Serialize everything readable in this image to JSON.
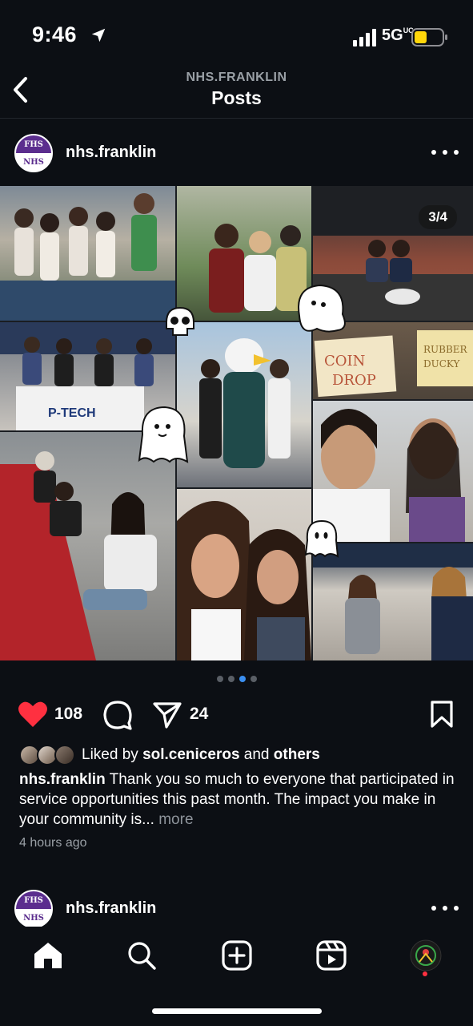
{
  "status_bar": {
    "time": "9:46",
    "network": "5G",
    "network_suffix": "UC"
  },
  "header": {
    "subtitle": "NHS.FRANKLIN",
    "title": "Posts"
  },
  "post": {
    "avatar_top_text": "FHS",
    "avatar_bottom_text": "NHS",
    "username": "nhs.franklin",
    "slide_counter": "3/4",
    "carousel": {
      "count": 4,
      "active_index": 2
    },
    "likes": "108",
    "shares": "24",
    "liked_by_prefix": "Liked by",
    "liked_by_user": "sol.ceniceros",
    "liked_by_and": "and",
    "liked_by_others": "others",
    "caption_username": "nhs.franklin",
    "caption_text": "Thank you so much to everyone that participated in service opportunities this past month. The impact you make in your community is...",
    "caption_more": "more",
    "time_ago": "4 hours ago"
  },
  "next_post": {
    "username": "nhs.franklin"
  },
  "colors": {
    "background": "#0c0f14",
    "like_red": "#ff3040",
    "accent_blue": "#3b8ff0",
    "school_purple": "#5b2d8e"
  },
  "icons": {
    "back": "chevron-left-icon",
    "like": "heart-icon",
    "comment": "comment-icon",
    "share": "paper-plane-icon",
    "save": "bookmark-icon",
    "home": "home-icon",
    "search": "search-icon",
    "create": "plus-square-icon",
    "reels": "reels-icon",
    "profile": "profile-avatar"
  }
}
